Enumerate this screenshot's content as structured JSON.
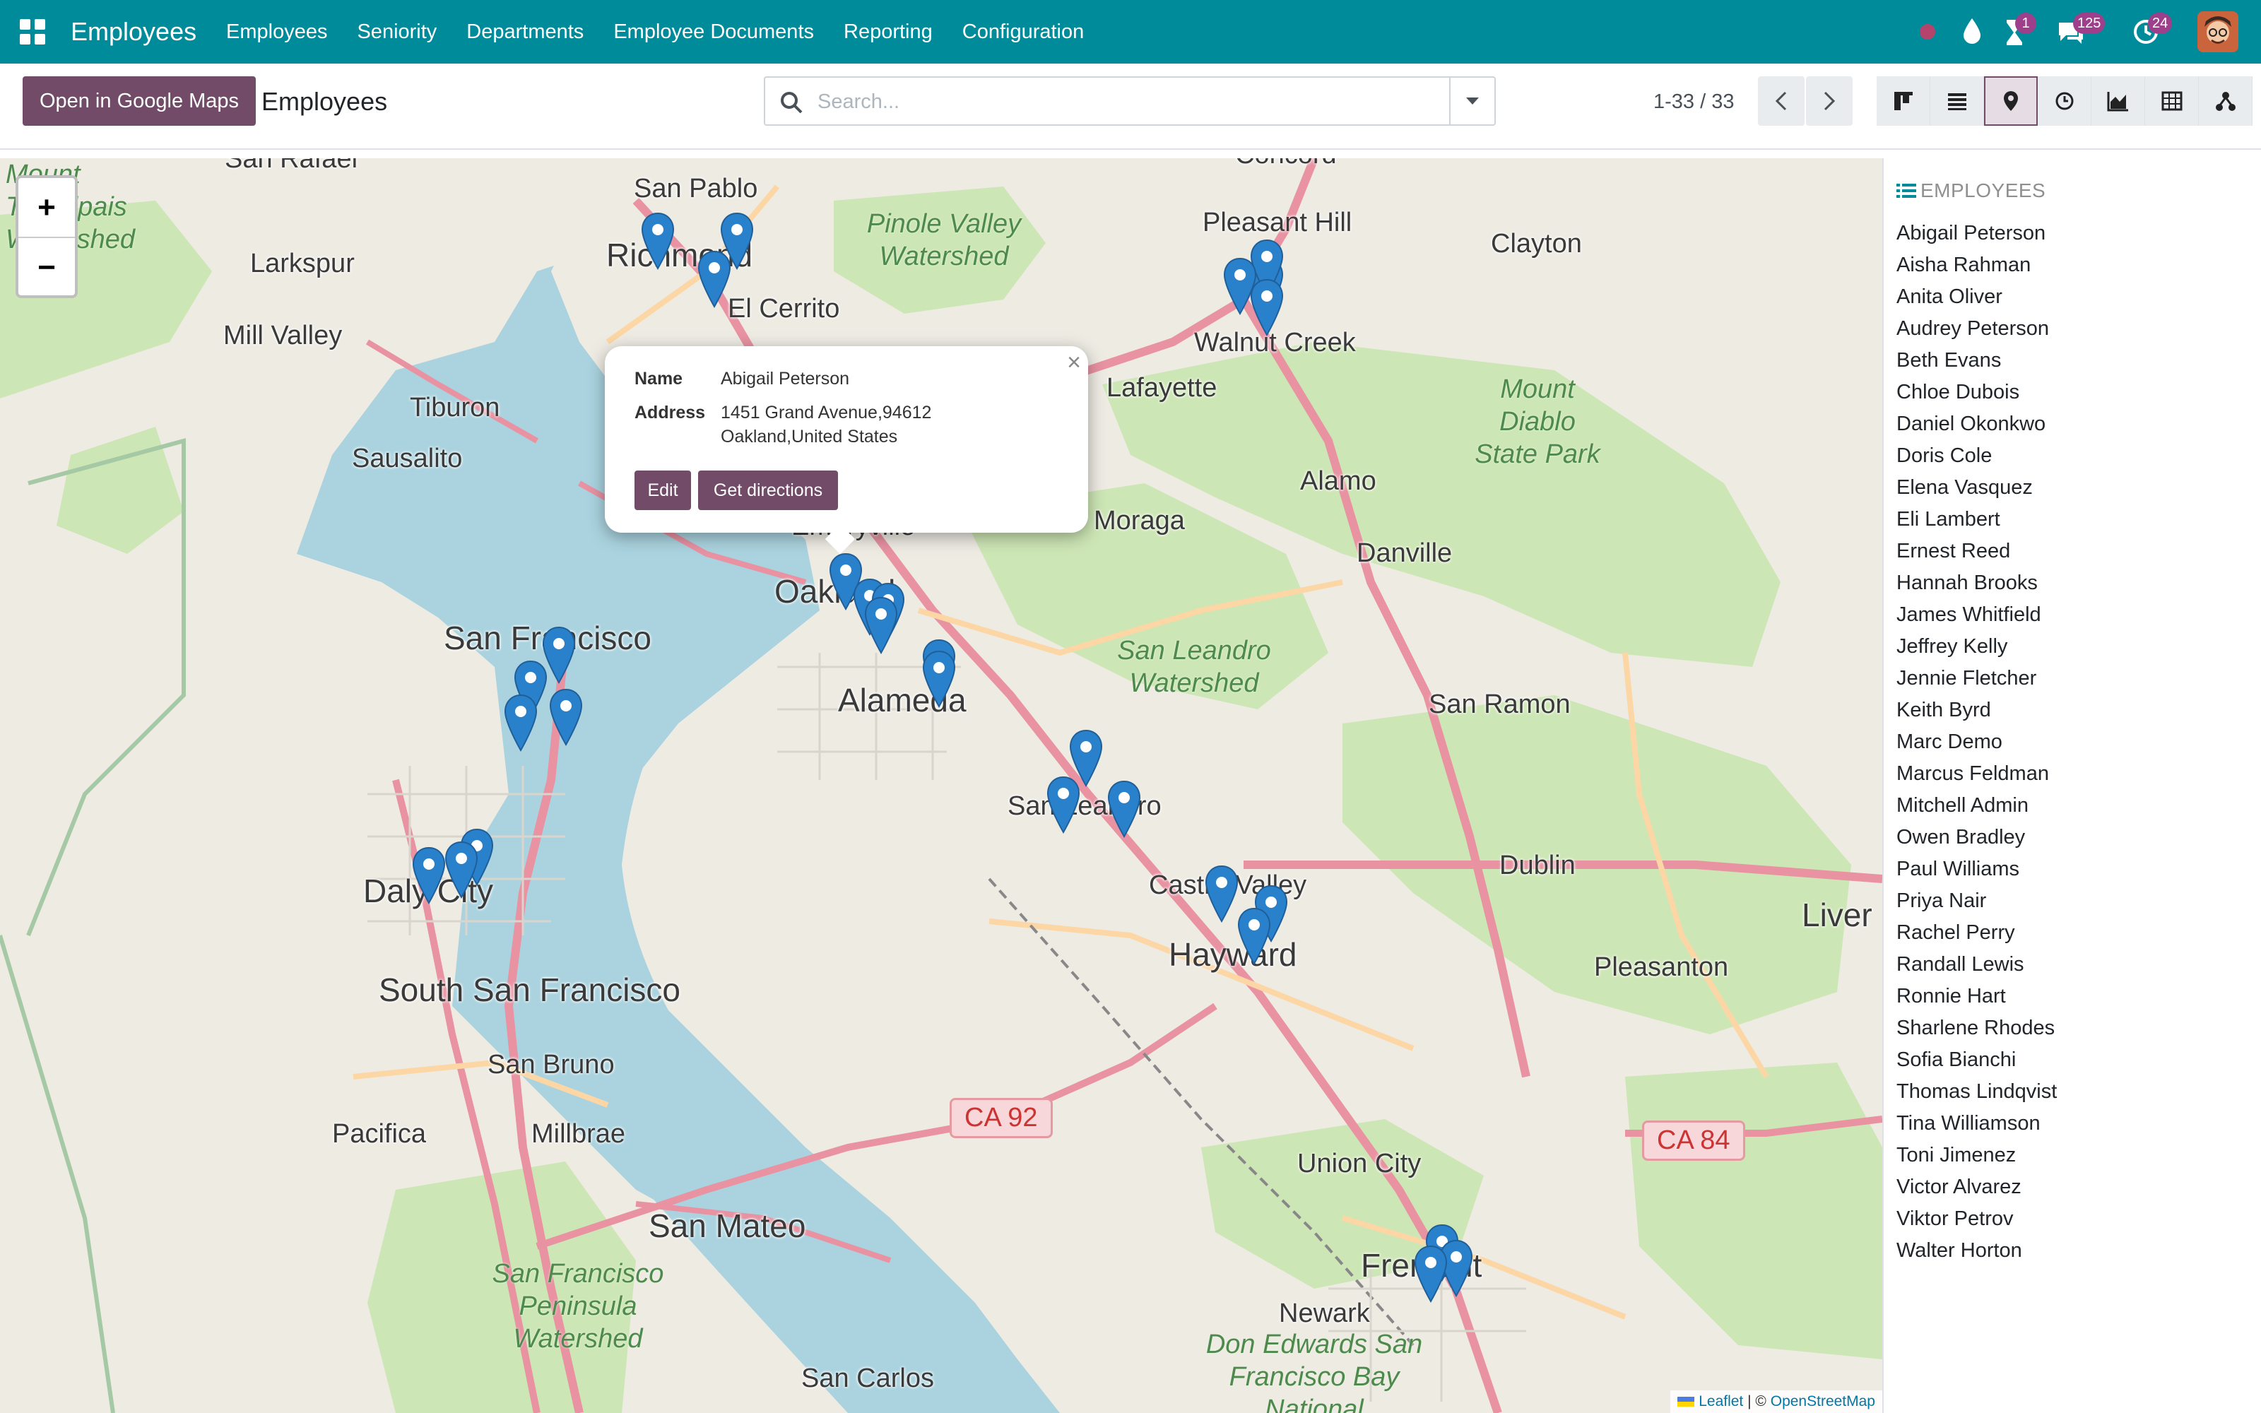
{
  "navbar": {
    "app_title": "Employees",
    "menu": [
      "Employees",
      "Seniority",
      "Departments",
      "Employee Documents",
      "Reporting",
      "Configuration"
    ],
    "badges": {
      "activities": "1",
      "messages": "125",
      "updates": "24"
    }
  },
  "control": {
    "gmaps_button": "Open in Google Maps",
    "breadcrumb": "Employees",
    "search_placeholder": "Search...",
    "pager": "1-33 / 33"
  },
  "popup": {
    "name_label": "Name",
    "name_value": "Abigail Peterson",
    "address_label": "Address",
    "address_line1": "1451 Grand Avenue,94612",
    "address_line2": "Oakland,United States",
    "edit_button": "Edit",
    "directions_button": "Get directions"
  },
  "map": {
    "zoom_in": "+",
    "zoom_out": "−",
    "attribution": {
      "leaflet": "Leaflet",
      "separator": "| ©",
      "osm": "OpenStreetMap"
    },
    "places": {
      "san_pablo": "San Pablo",
      "richmond": "Richmond",
      "el_cerrito": "El Cerrito",
      "larkspur": "Larkspur",
      "mill_valley": "Mill Valley",
      "tiburon": "Tiburon",
      "sausalito": "Sausalito",
      "san_francisco": "San Francisco",
      "daly_city": "Daly City",
      "south_sf": "South San Francisco",
      "san_bruno": "San Bruno",
      "pacifica": "Pacifica",
      "millbrae": "Millbrae",
      "san_mateo": "San Mateo",
      "san_carlos": "San Carlos",
      "oakland": "Oakland",
      "emeryville": "Emeryville",
      "alameda": "Alameda",
      "san_leandro": "San Leandro",
      "castro_valley": "Castro Valley",
      "hayward": "Hayward",
      "union_city": "Union City",
      "fremont": "Fremont",
      "newark": "Newark",
      "pleasant_hill": "Pleasant Hill",
      "clayton": "Clayton",
      "walnut_creek": "Walnut Creek",
      "lafayette": "Lafayette",
      "moraga": "Moraga",
      "alamo": "Alamo",
      "danville": "Danville",
      "san_ramon": "San Ramon",
      "dublin": "Dublin",
      "pleasanton": "Pleasanton",
      "livermore": "Liver",
      "concord": "Concord",
      "san_rafael": "San Rafael"
    },
    "green_areas": {
      "pinole": "Pinole Valley Watershed",
      "mount_diablo": "Mount Diablo State Park",
      "san_leandro_ws": "San Leandro Watershed",
      "peninsula_ws": "San Francisco Peninsula Watershed",
      "tamalpais": "Mount Tamalpais Watershed",
      "don_edwards": "Don Edwards San Francisco Bay National"
    },
    "shields": {
      "ca92": "CA 92",
      "ca84": "CA 84"
    }
  },
  "sidebar": {
    "title": "EMPLOYEES",
    "employees": [
      "Abigail Peterson",
      "Aisha Rahman",
      "Anita Oliver",
      "Audrey Peterson",
      "Beth Evans",
      "Chloe Dubois",
      "Daniel Okonkwo",
      "Doris Cole",
      "Elena Vasquez",
      "Eli Lambert",
      "Ernest Reed",
      "Hannah Brooks",
      "James Whitfield",
      "Jeffrey Kelly",
      "Jennie Fletcher",
      "Keith Byrd",
      "Marc Demo",
      "Marcus Feldman",
      "Mitchell Admin",
      "Owen Bradley",
      "Paul Williams",
      "Priya Nair",
      "Rachel Perry",
      "Randall Lewis",
      "Ronnie Hart",
      "Sharlene Rhodes",
      "Sofia Bianchi",
      "Thomas Lindqvist",
      "Tina Williamson",
      "Toni Jimenez",
      "Victor Alvarez",
      "Viktor Petrov",
      "Walter Horton"
    ]
  },
  "colors": {
    "navbar": "#008b9a",
    "primary": "#714b67",
    "marker": "#2a81cb",
    "water": "#aad3df"
  }
}
